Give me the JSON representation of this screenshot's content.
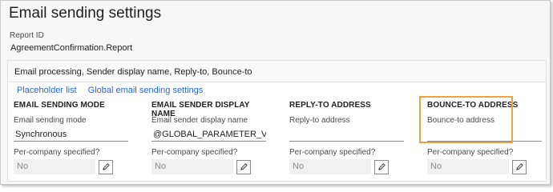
{
  "page": {
    "title": "Email sending settings",
    "report_id_label": "Report ID",
    "report_id_value": "AgreementConfirmation.Report"
  },
  "panel": {
    "header": "Email processing, Sender display name, Reply-to, Bounce-to",
    "links": {
      "placeholder_list": "Placeholder list",
      "global_settings": "Global email sending settings"
    }
  },
  "columns": [
    {
      "heading": "EMAIL SENDING MODE",
      "field_label": "Email sending mode",
      "field_value": "Synchronous",
      "field_placeholder": "",
      "pcs_label": "Per-company specified?",
      "pcs_value": "No"
    },
    {
      "heading": "EMAIL SENDER DISPLAY NAME",
      "field_label": "Email sender display name",
      "field_value": "@GLOBAL_PARAMETER_VAL...",
      "field_placeholder": "",
      "pcs_label": "Per-company specified?",
      "pcs_value": "No"
    },
    {
      "heading": "REPLY-TO ADDRESS",
      "field_label": "Reply-to address",
      "field_value": "",
      "field_placeholder": "",
      "pcs_label": "Per-company specified?",
      "pcs_value": "No"
    },
    {
      "heading": "BOUNCE-TO ADDRESS",
      "field_label": "Bounce-to address",
      "field_value": "",
      "field_placeholder": "",
      "pcs_label": "Per-company specified?",
      "pcs_value": "No"
    }
  ],
  "icons": {
    "edit": "pencil-icon"
  },
  "colors": {
    "link": "#2266e3",
    "highlight": "#f0a040"
  }
}
